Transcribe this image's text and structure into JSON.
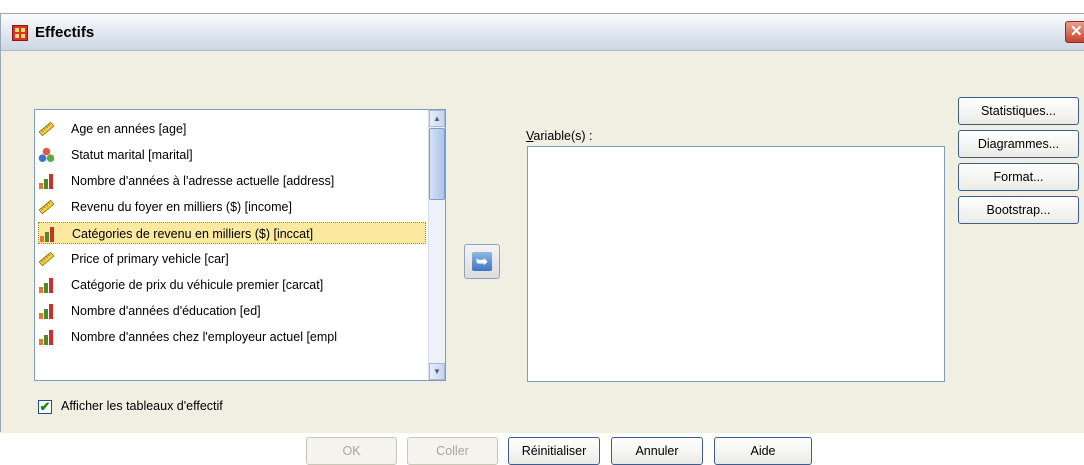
{
  "window": {
    "title": "Effectifs",
    "close_glyph": "✕"
  },
  "source_list": {
    "items": [
      {
        "label": "Age en années [age]",
        "icon": "scale-ruler-icon"
      },
      {
        "label": "Statut marital [marital]",
        "icon": "nominal-balls-icon"
      },
      {
        "label": "Nombre d'années à l'adresse actuelle [address]",
        "icon": "ordinal-bars-icon"
      },
      {
        "label": "Revenu du foyer en milliers ($) [income]",
        "icon": "scale-ruler-icon"
      },
      {
        "label": "Catégories de revenu en milliers ($) [inccat]",
        "icon": "ordinal-bars-icon",
        "selected": true
      },
      {
        "label": "Price of primary vehicle [car]",
        "icon": "scale-ruler-icon"
      },
      {
        "label": "Catégorie de prix du véhicule premier [carcat]",
        "icon": "ordinal-bars-icon"
      },
      {
        "label": "Nombre d'années d'éducation [ed]",
        "icon": "ordinal-bars-icon"
      },
      {
        "label": "Nombre d'années chez l'employeur actuel [empl",
        "icon": "ordinal-bars-icon"
      }
    ]
  },
  "move_button": {
    "glyph": "➥"
  },
  "target": {
    "label": "Variable(s) :"
  },
  "side_buttons": {
    "statistics": "Statistiques...",
    "charts": "Diagrammes...",
    "format": "Format...",
    "bootstrap": "Bootstrap..."
  },
  "checkbox": {
    "label": "Afficher les tableaux d'effectif",
    "checked": true,
    "check_glyph": "✔"
  },
  "bottom_buttons": {
    "ok": "OK",
    "paste": "Coller",
    "reset": "Réinitialiser",
    "cancel": "Annuler",
    "help": "Aide"
  },
  "colors": {
    "selection_bg": "#fae99e",
    "dialog_bg": "#f1efe2",
    "close_red": "#c8432c"
  }
}
